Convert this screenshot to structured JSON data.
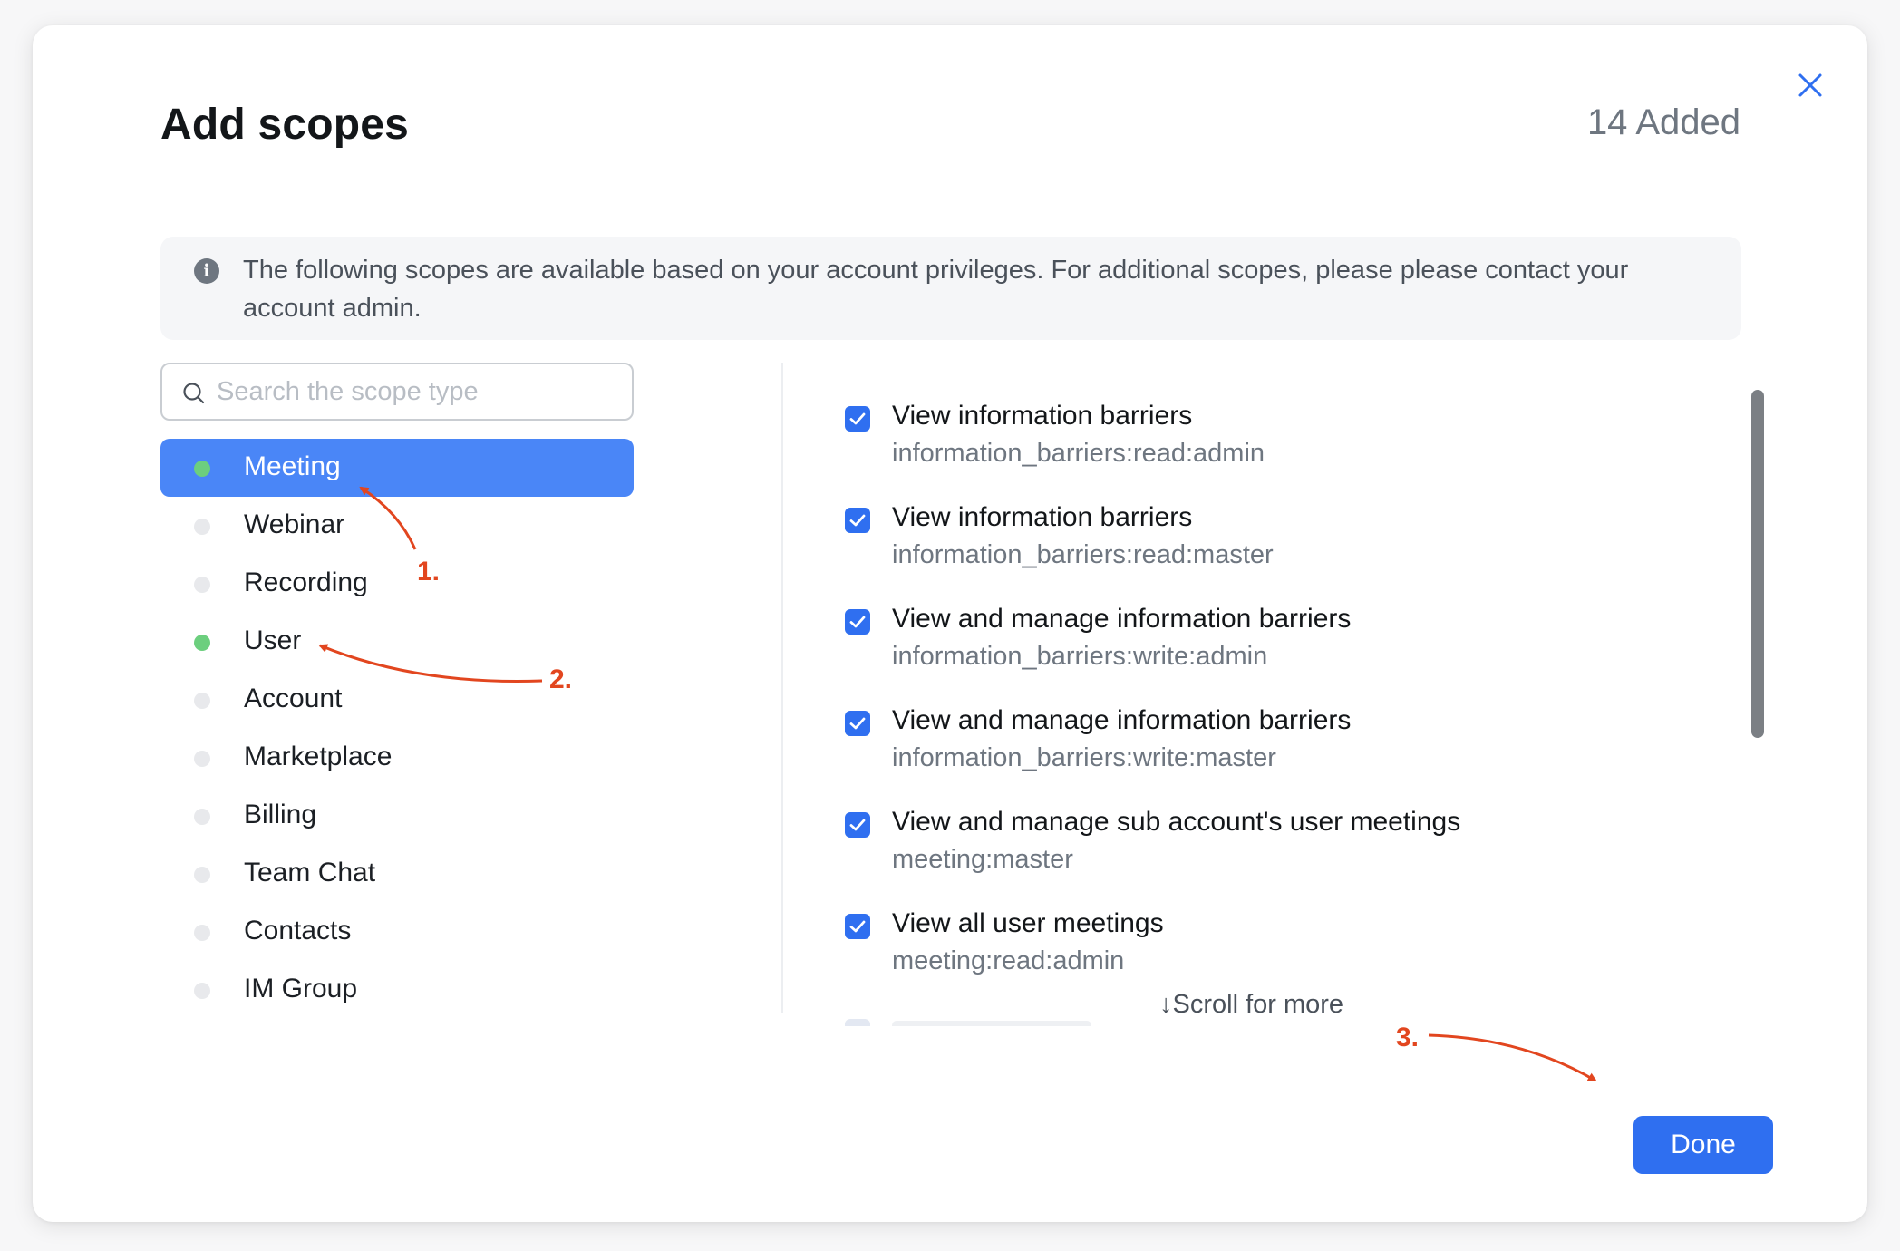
{
  "dialog": {
    "title": "Add scopes",
    "added_count": "14 Added",
    "close_icon": "close-icon"
  },
  "info": {
    "icon": "info-icon",
    "text": "The following scopes are available based on your account privileges. For additional scopes, please please contact your account admin."
  },
  "search": {
    "placeholder": "Search the scope type",
    "value": ""
  },
  "categories": [
    {
      "label": "Meeting",
      "has_selection": true,
      "active": true
    },
    {
      "label": "Webinar",
      "has_selection": false,
      "active": false
    },
    {
      "label": "Recording",
      "has_selection": false,
      "active": false
    },
    {
      "label": "User",
      "has_selection": true,
      "active": false
    },
    {
      "label": "Account",
      "has_selection": false,
      "active": false
    },
    {
      "label": "Marketplace",
      "has_selection": false,
      "active": false
    },
    {
      "label": "Billing",
      "has_selection": false,
      "active": false
    },
    {
      "label": "Team Chat",
      "has_selection": false,
      "active": false
    },
    {
      "label": "Contacts",
      "has_selection": false,
      "active": false
    },
    {
      "label": "IM Group",
      "has_selection": false,
      "active": false
    }
  ],
  "scopes": [
    {
      "title": "View information barriers",
      "key": "information_barriers:read:admin",
      "checked": true
    },
    {
      "title": "View information barriers",
      "key": "information_barriers:read:master",
      "checked": true
    },
    {
      "title": "View and manage information barriers",
      "key": "information_barriers:write:admin",
      "checked": true
    },
    {
      "title": "View and manage information barriers",
      "key": "information_barriers:write:master",
      "checked": true
    },
    {
      "title": "View and manage sub account's user meetings",
      "key": "meeting:master",
      "checked": true
    },
    {
      "title": "View all user meetings",
      "key": "meeting:read:admin",
      "checked": true
    }
  ],
  "scroll_hint": "↓Scroll for more",
  "footer": {
    "done_label": "Done"
  },
  "annotations": {
    "step1": "1.",
    "step2": "2.",
    "step3": "3.",
    "color": "#e2461f"
  },
  "colors": {
    "accent": "#2f6ff0",
    "active_category": "#4a86f7",
    "selected_dot": "#6ccf7e"
  }
}
